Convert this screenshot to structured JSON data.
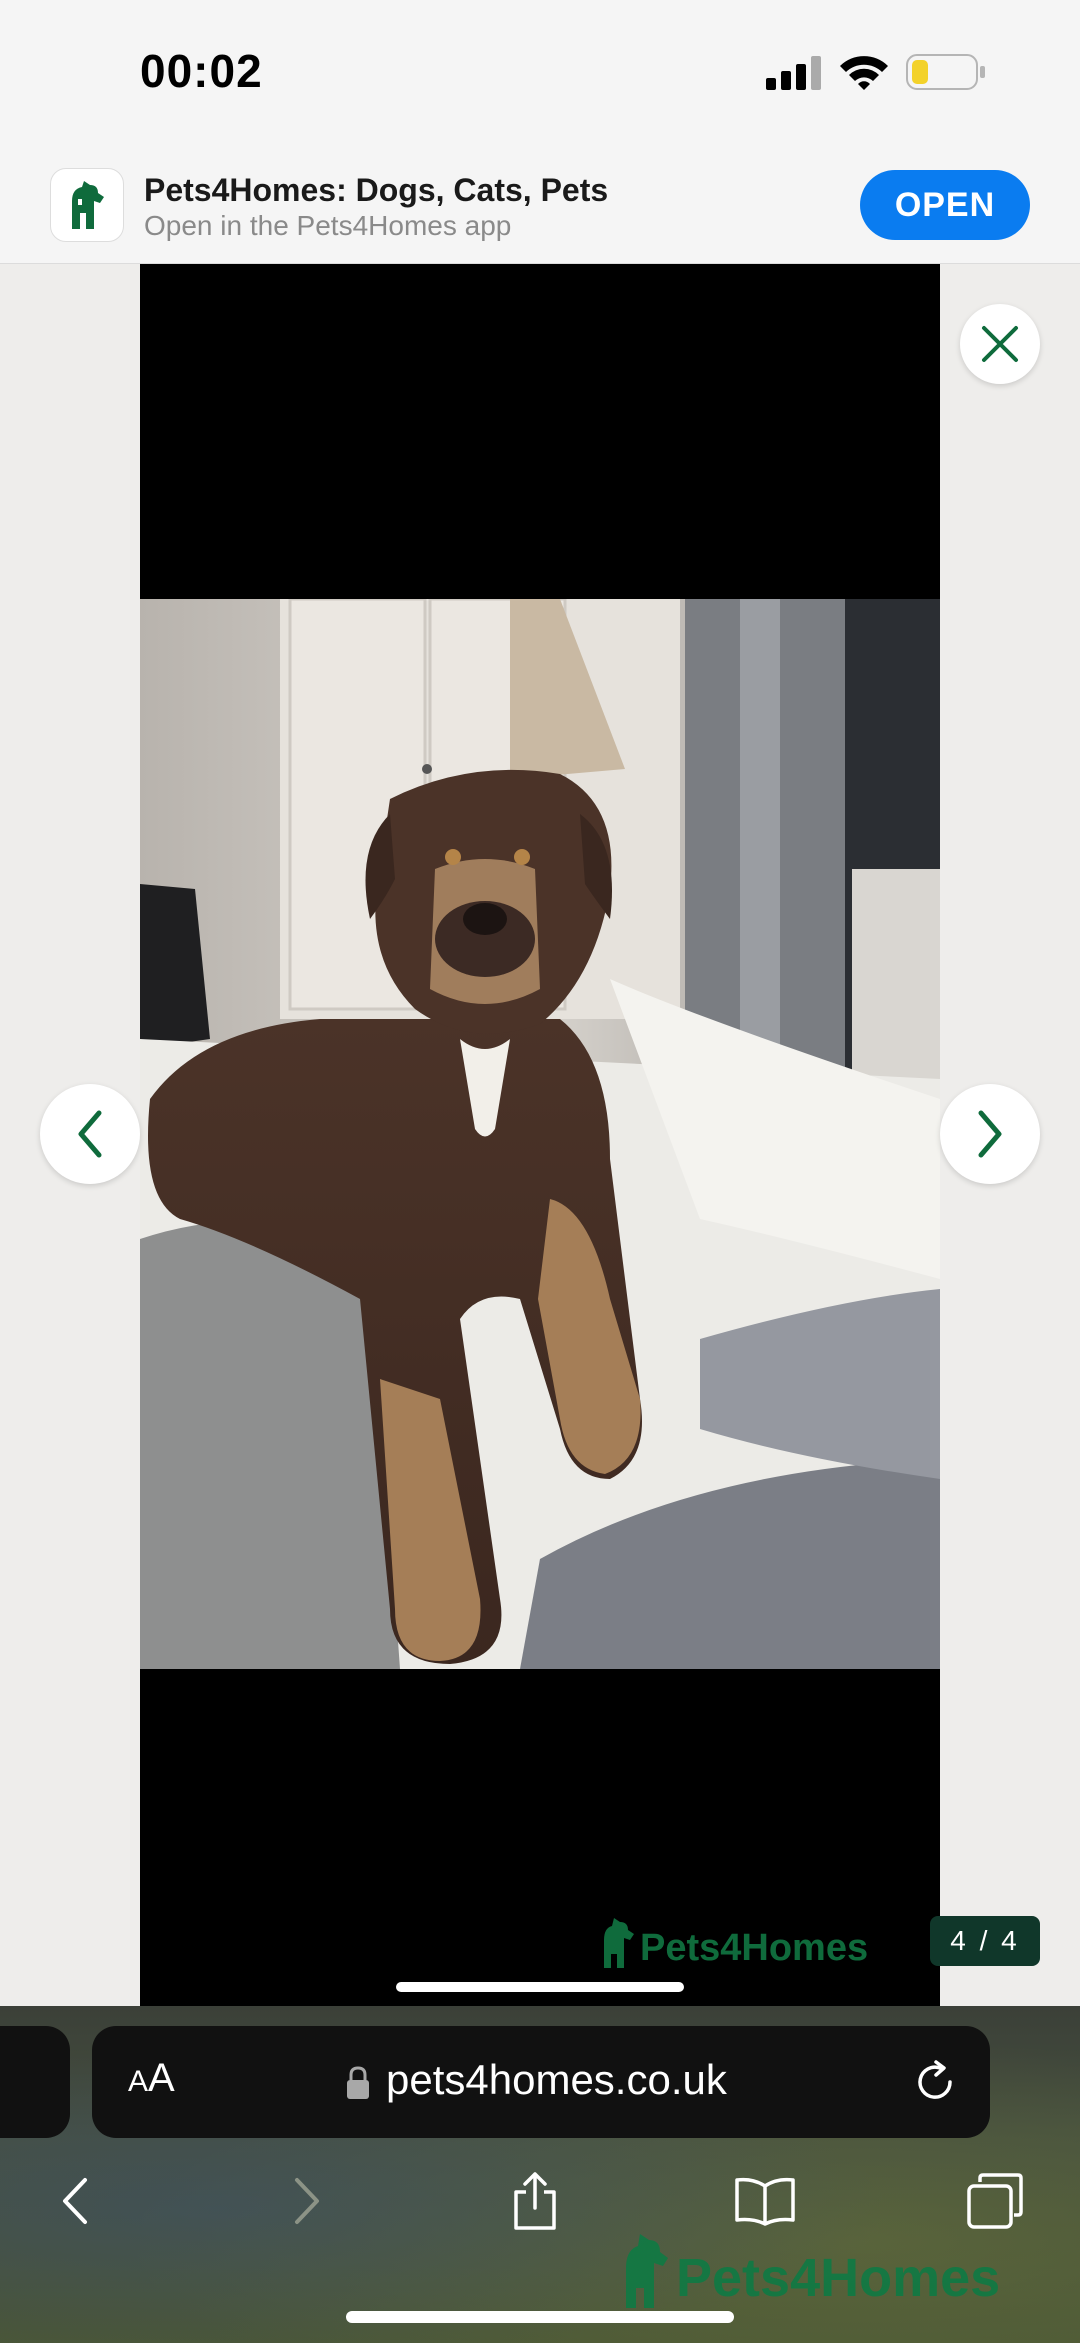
{
  "status_bar": {
    "time": "00:02",
    "icons": [
      "cellular-signal-icon",
      "wifi-icon",
      "battery-low-icon"
    ]
  },
  "app_banner": {
    "title": "Pets4Homes: Dogs, Cats, Pets",
    "subtitle": "Open in the Pets4Homes app",
    "open_label": "OPEN",
    "icon": "pets4homes-app-icon",
    "accent": "#0a7cf0"
  },
  "gallery": {
    "counter": "4 / 4",
    "watermark": "Pets4Homes",
    "photo": "brown-dog-lying-on-bed-photo",
    "brand_color": "#0f6b3c",
    "icons": [
      "close-icon",
      "chevron-left-icon",
      "chevron-right-icon"
    ]
  },
  "browser": {
    "text_size_label_small": "A",
    "text_size_label_big": "A",
    "url": "pets4homes.co.uk",
    "icons": [
      "lock-icon",
      "reload-icon",
      "back-icon",
      "forward-icon",
      "share-icon",
      "bookmarks-icon",
      "tabs-icon"
    ]
  }
}
